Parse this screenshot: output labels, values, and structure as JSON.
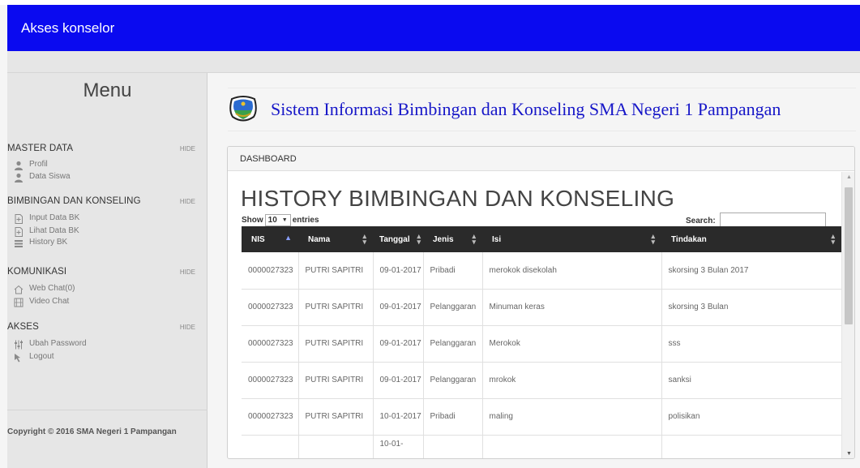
{
  "app": {
    "title": "Akses konselor"
  },
  "sidebar": {
    "menu_title": "Menu",
    "sections": [
      {
        "label": "MASTER DATA",
        "hide": "HIDE",
        "items": [
          {
            "label": "Profil",
            "icon": "user-icon"
          },
          {
            "label": "Data Siswa",
            "icon": "user-icon"
          }
        ]
      },
      {
        "label": "BIMBINGAN DAN KONSELING",
        "hide": "HIDE",
        "items": [
          {
            "label": "Input Data BK",
            "icon": "file-add-icon"
          },
          {
            "label": "Lihat Data BK",
            "icon": "file-add-icon"
          },
          {
            "label": "History BK",
            "icon": "list-icon"
          }
        ]
      },
      {
        "label": "KOMUNIKASI",
        "hide": "HIDE",
        "items": [
          {
            "label": "Web Chat(0)",
            "icon": "home-icon"
          },
          {
            "label": "Video Chat",
            "icon": "film-icon"
          }
        ]
      },
      {
        "label": "AKSES",
        "hide": "HIDE",
        "items": [
          {
            "label": "Ubah Password",
            "icon": "sliders-icon"
          },
          {
            "label": "Logout",
            "icon": "cursor-icon"
          }
        ]
      }
    ],
    "copyright": "Copyright © 2016 SMA Negeri 1 Pampangan"
  },
  "header": {
    "site_title": "Sistem Informasi Bimbingan dan Konseling SMA Negeri 1 Pampangan"
  },
  "panel": {
    "heading": "DASHBOARD",
    "title": "HISTORY BIMBINGAN DAN KONSELING",
    "show_label": "Show",
    "entries_value": "10",
    "entries_label": "entries",
    "search_label": "Search:",
    "search_value": ""
  },
  "table": {
    "columns": [
      "NIS",
      "Nama",
      "Tanggal",
      "Jenis",
      "Isi",
      "Tindakan"
    ],
    "rows": [
      [
        "0000027323",
        "PUTRI SAPITRI",
        "09-01-2017",
        "Pribadi",
        "merokok disekolah",
        "skorsing 3 Bulan 2017"
      ],
      [
        "0000027323",
        "PUTRI SAPITRI",
        "09-01-2017",
        "Pelanggaran",
        "Minuman keras",
        "skorsing 3 Bulan"
      ],
      [
        "0000027323",
        "PUTRI SAPITRI",
        "09-01-2017",
        "Pelanggaran",
        "Merokok",
        "sss"
      ],
      [
        "0000027323",
        "PUTRI SAPITRI",
        "09-01-2017",
        "Pelanggaran",
        "mrokok",
        "sanksi"
      ],
      [
        "0000027323",
        "PUTRI SAPITRI",
        "10-01-2017",
        "Pribadi",
        "maling",
        "polisikan"
      ]
    ],
    "partial_row_date": "10-01-"
  },
  "colors": {
    "topbar": "#0a0af0",
    "site_title": "#1717c8",
    "table_header": "#2a2a2a"
  }
}
